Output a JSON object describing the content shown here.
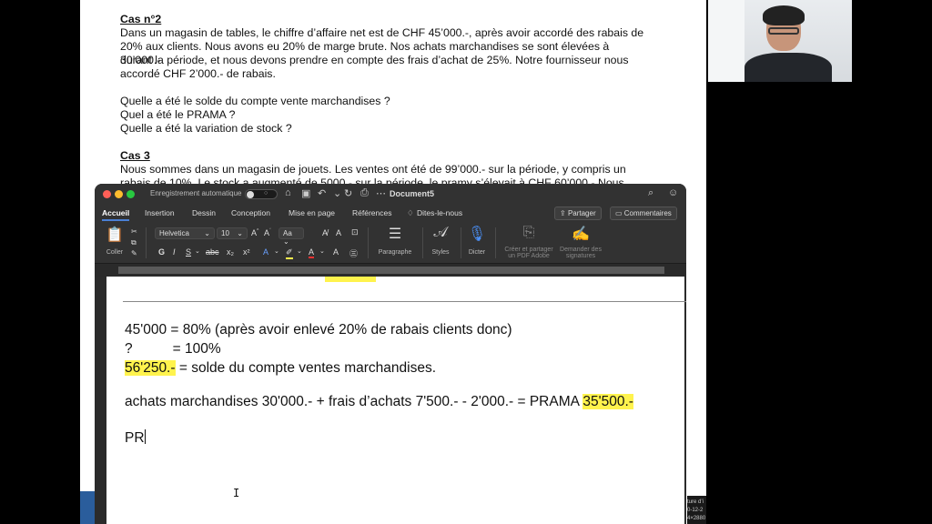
{
  "background_doc": {
    "case2_title": "Cas n°2",
    "case2_lines": [
      "Dans un magasin de tables, le chiffre d’affaire net est de CHF 45’000.-, après avoir accordé des rabais de",
      "20% aux clients. Nous avons eu 20% de marge brute. Nos achats marchandises se sont élevées à 30’000.-",
      "durant la période, et nous devons prendre en compte des frais d’achat de 25%. Notre fournisseur nous",
      "accordé CHF 2’000.- de rabais."
    ],
    "questions": [
      "Quelle a été le solde du compte vente marchandises ?",
      "Quel a été le PRAMA ?",
      "Quelle a été la variation de stock ?"
    ],
    "case3_title": "Cas 3",
    "case3_lines": [
      "Nous sommes dans un magasin de jouets. Les ventes ont été de 99’000.- sur la période, y compris un",
      "rabais de 10%. Le stock a augmenté de 5000.- sur la période, le pramy s’élevait à CHF 60’000.- Nous"
    ]
  },
  "word": {
    "autosave_label": "Enregistrement automatique",
    "autosave_state": "off",
    "doc_title": "Document5",
    "tabs": [
      "Accueil",
      "Insertion",
      "Dessin",
      "Conception",
      "Mise en page",
      "Références",
      "Dites-le-nous"
    ],
    "share_label": "Partager",
    "comments_label": "Commentaires",
    "ribbon": {
      "paste_label": "Coller",
      "font_name": "Helvetica",
      "font_size": "10",
      "paragraph_label": "Paragraphe",
      "styles_label": "Styles",
      "dictate_label": "Dicter",
      "adobe_label_1": "Créer et partager",
      "adobe_label_2": "un PDF Adobe",
      "sign_label_1": "Demander des",
      "sign_label_2": "signatures"
    },
    "document": {
      "line1": "45'000 = 80% (après avoir enlevé 20% de rabais clients donc)",
      "line2_q": "?",
      "line2_rest": "= 100%",
      "line3_hl": "56'250.-",
      "line3_rest": " = solde du compte ventes marchandises.",
      "line4_text": "achats marchandises 30'000.- + frais d’achats 7'500.- - 2'000.- = PRAMA ",
      "line4_hl": "35'500.-",
      "line5": "PR"
    }
  },
  "right_snippet": [
    "ture d’i",
    "0-12-2",
    "4×2880"
  ],
  "colors": {
    "highlight": "#fff34d",
    "window_bg": "#2b2b2b",
    "accent": "#4a7fd4"
  }
}
